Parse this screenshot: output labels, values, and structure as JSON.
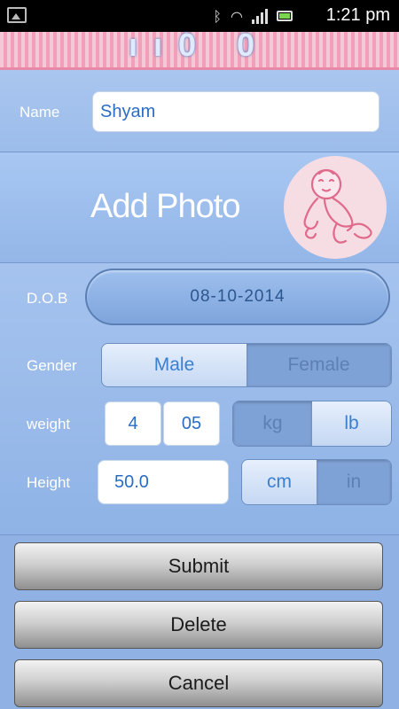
{
  "status_bar": {
    "time": "1:21 pm",
    "icons": [
      "image-icon",
      "bluetooth-icon",
      "wifi-icon",
      "signal-icon",
      "battery-icon"
    ]
  },
  "header": {
    "title": "ıı0  0"
  },
  "name_section": {
    "label": "Name",
    "value": "Shyam"
  },
  "photo_section": {
    "label": "Add Photo"
  },
  "form": {
    "dob_label": "D.O.B",
    "dob_value": "08-10-2014",
    "gender_label": "Gender",
    "gender_options": [
      "Male",
      "Female"
    ],
    "gender_selected": "Male",
    "weight_label": "weight",
    "weight_major": "4",
    "weight_minor": "05",
    "weight_units": [
      "kg",
      "lb"
    ],
    "weight_unit_selected": "lb",
    "height_label": "Height",
    "height_value": "50.0",
    "height_units": [
      "cm",
      "in"
    ],
    "height_unit_selected": "cm"
  },
  "buttons": {
    "submit": "Submit",
    "delete": "Delete",
    "cancel": "Cancel"
  },
  "colors": {
    "background": "#8fb3e6",
    "accent_text": "#2a6cc6",
    "header_stripe_pink": "#f39fb9"
  }
}
